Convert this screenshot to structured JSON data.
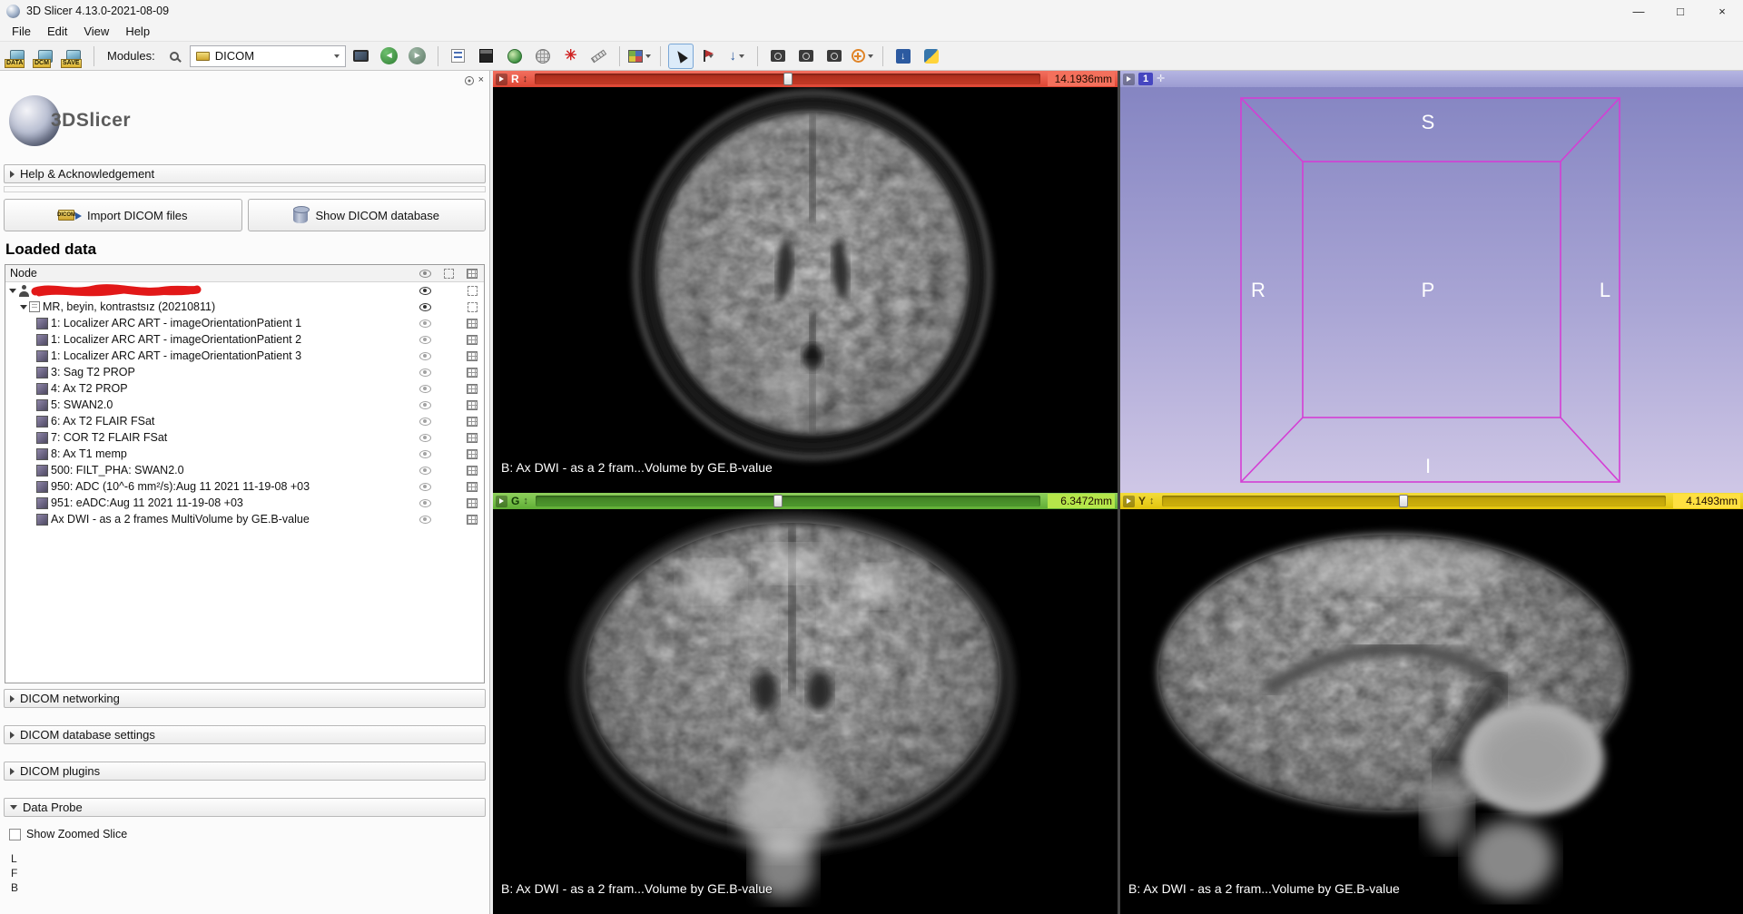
{
  "window": {
    "title": "3D Slicer 4.13.0-2021-08-09",
    "controls": {
      "minimize": "—",
      "maximize": "□",
      "close": "×"
    }
  },
  "menu": {
    "items": [
      "File",
      "Edit",
      "View",
      "Help"
    ]
  },
  "toolbar": {
    "data_label": "DATA",
    "dcm_label": "DCM",
    "save_label": "SAVE",
    "modules_label": "Modules:",
    "module_value": "DICOM"
  },
  "panel": {
    "close_glyph": "×",
    "logo_text": "3DSlicer",
    "help_section_label": "Help & Acknowledgement",
    "import_dicom_label": "Import DICOM files",
    "show_db_label": "Show DICOM database",
    "loaded_data_title": "Loaded data",
    "tree": {
      "header": "Node",
      "study_label": "MR, beyin, kontrastsız (20210811)",
      "series": [
        "1: Localizer ARC ART - imageOrientationPatient 1",
        "1: Localizer ARC ART - imageOrientationPatient 2",
        "1: Localizer ARC ART - imageOrientationPatient 3",
        "3: Sag T2 PROP",
        "4: Ax T2 PROP",
        "5: SWAN2.0",
        "6: Ax T2 FLAIR FSat",
        "7: COR T2 FLAIR FSat",
        "8: Ax T1 memp",
        "500: FILT_PHA: SWAN2.0",
        "950: ADC (10^-6 mm²/s):Aug 11 2021 11-19-08 +03",
        "951: eADC:Aug 11 2021 11-19-08 +03",
        "Ax DWI - as a 2 frames MultiVolume by GE.B-value"
      ]
    },
    "sections": [
      {
        "label": "DICOM networking",
        "expanded": false
      },
      {
        "label": "DICOM database settings",
        "expanded": false
      },
      {
        "label": "DICOM plugins",
        "expanded": false
      },
      {
        "label": "Data Probe",
        "expanded": true
      }
    ],
    "show_zoomed_slice_label": "Show Zoomed Slice",
    "probe_lines": [
      "L",
      "F",
      "B"
    ]
  },
  "views": {
    "caption": "B: Ax DWI - as a 2 fram...Volume by GE.B-value",
    "red": {
      "axis": "R",
      "offset": "14.1936mm",
      "handle_pct": 50
    },
    "green": {
      "axis": "G",
      "offset": "6.3472mm",
      "handle_pct": 48
    },
    "yellow": {
      "axis": "Y",
      "offset": "4.1493mm",
      "handle_pct": 48
    },
    "threeD": {
      "badge": "1",
      "orientation": {
        "top": "S",
        "left": "R",
        "center": "P",
        "right": "L",
        "bottom": "I"
      }
    }
  },
  "colors": {
    "red_bar": "#e65646",
    "green_bar": "#6fba3c",
    "yellow_bar": "#edd317",
    "cube_wireframe": "#d43ed4"
  }
}
